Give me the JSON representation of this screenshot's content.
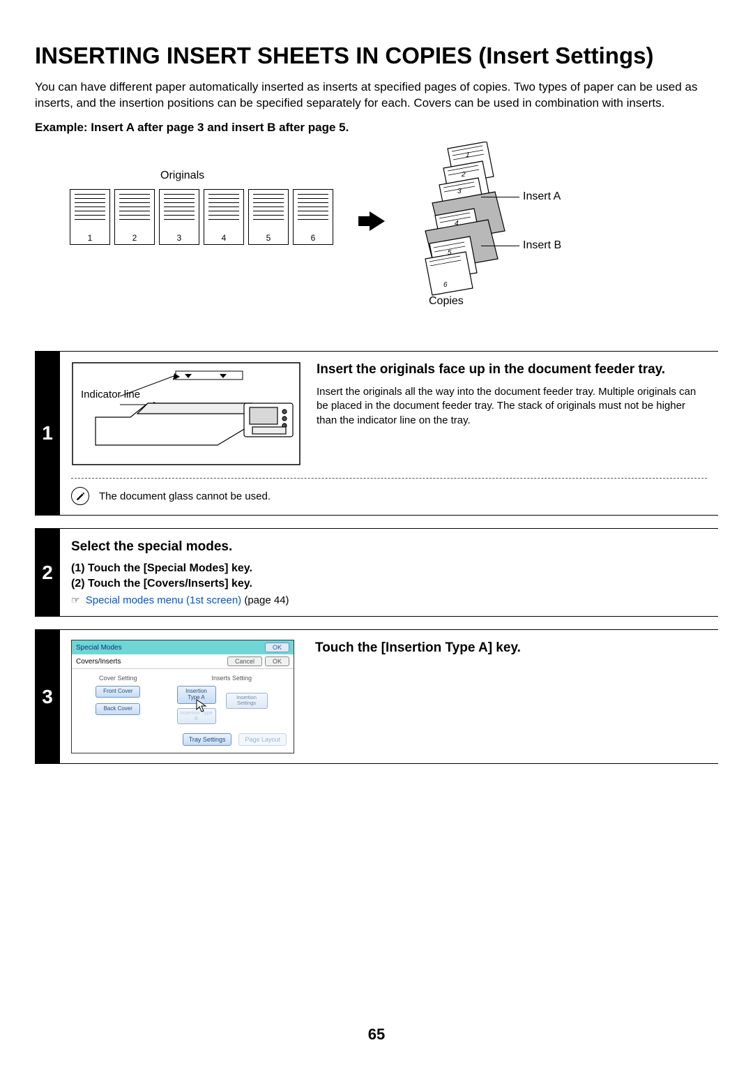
{
  "title": "INSERTING INSERT SHEETS IN COPIES (Insert Settings)",
  "intro": "You can have different paper automatically inserted as inserts at specified pages of copies. Two types of paper can be used as inserts, and the insertion positions can be specified separately for each.\nCovers can be used in combination with inserts.",
  "example_label": "Example: Insert A after page 3 and insert B after page 5.",
  "diagram": {
    "originals_label": "Originals",
    "copies_label": "Copies",
    "page_numbers": [
      "1",
      "2",
      "3",
      "4",
      "5",
      "6"
    ],
    "stack_numbers": [
      "1",
      "2",
      "3",
      "4",
      "5",
      "6"
    ],
    "insert_a": "Insert A",
    "insert_b": "Insert B"
  },
  "step1": {
    "num": "1",
    "indicator": "Indicator line",
    "heading": "Insert the originals face up in the document feeder tray.",
    "text": "Insert the originals all the way into the document feeder tray. Multiple originals can be placed in the document feeder tray. The stack of originals must not be higher than the indicator line on the tray.",
    "note": "The document glass cannot be used."
  },
  "step2": {
    "num": "2",
    "heading": "Select the special modes.",
    "items": [
      "(1)  Touch the [Special Modes] key.",
      "(2)  Touch the [Covers/Inserts] key."
    ],
    "crossref_link": "Special modes menu (1st screen)",
    "crossref_page": "(page 44)"
  },
  "step3": {
    "num": "3",
    "heading": "Touch the [Insertion Type A] key.",
    "panel": {
      "bar_title": "Special Modes",
      "bar_ok": "OK",
      "sub_title": "Covers/Inserts",
      "cancel": "Cancel",
      "sub_ok": "OK",
      "col_cover": "Cover Setting",
      "col_inserts": "Inserts Setting",
      "front_cover": "Front Cover",
      "back_cover": "Back Cover",
      "ins_type_a": "Insertion Type A",
      "ins_type_b": "Insertion Type B",
      "ins_settings": "Insertion Settings",
      "tray_settings": "Tray Settings",
      "page_layout": "Page Layout"
    }
  },
  "page_number": "65"
}
